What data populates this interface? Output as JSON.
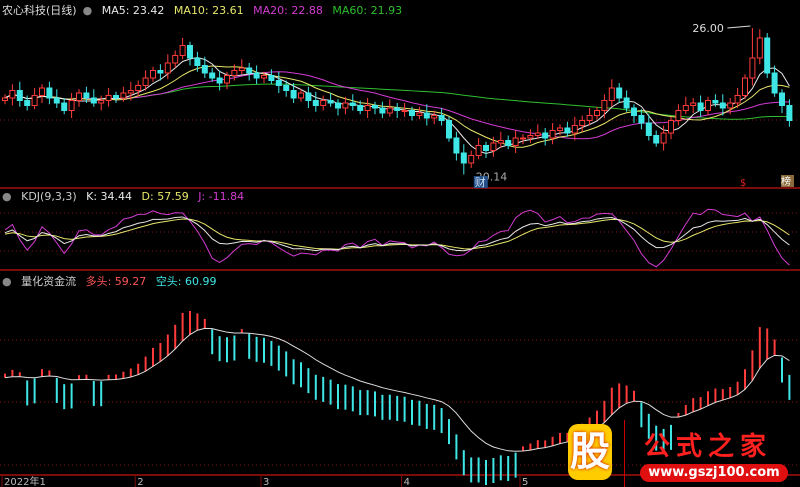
{
  "header": {
    "stock_name": "农心科技(日线)",
    "ma5_label": "MA5: 23.42",
    "ma10_label": "MA10: 23.61",
    "ma20_label": "MA20: 22.88",
    "ma60_label": "MA60: 21.93"
  },
  "kdj_header": {
    "title": "KDJ(9,3,3)",
    "k": "K: 34.44",
    "d": "D: 57.59",
    "j": "J: -11.84"
  },
  "flow_header": {
    "title": "量化资金流",
    "long": "多头: 59.27",
    "short": "空头: 60.99"
  },
  "annotations": {
    "high": "26.00",
    "low": "20.14",
    "badge_finance": "财",
    "badge_dollar": "$",
    "badge_right": "榜"
  },
  "xaxis": [
    "2022年1",
    "2",
    "3",
    "4",
    "5"
  ],
  "watermark": {
    "char": "股",
    "name": "公式之家",
    "url": "www.gszj100.com"
  },
  "colors": {
    "up": "#ff3b3b",
    "down": "#3ee6e6",
    "ma5": "#e8e8e8",
    "ma10": "#e6e66a",
    "ma20": "#d23cd2",
    "ma60": "#2fbf2f",
    "grid": "#8a1010"
  },
  "chart_data": {
    "type": "candlestick",
    "ylim": [
      19.8,
      26.4
    ],
    "month_start_index": [
      0,
      18,
      35,
      54,
      70
    ],
    "close": [
      23.2,
      23.5,
      23.1,
      22.9,
      23.3,
      23.6,
      23.2,
      23.0,
      22.7,
      23.1,
      23.4,
      23.2,
      23.0,
      23.1,
      23.3,
      23.2,
      23.4,
      23.5,
      23.7,
      24.0,
      24.3,
      24.2,
      24.6,
      24.9,
      25.3,
      24.8,
      24.5,
      24.2,
      24.0,
      23.8,
      24.1,
      24.3,
      24.4,
      24.2,
      24.0,
      24.1,
      23.9,
      23.7,
      23.5,
      23.2,
      23.4,
      23.1,
      22.9,
      23.1,
      23.0,
      22.8,
      23.0,
      22.9,
      22.7,
      22.9,
      22.8,
      22.6,
      22.8,
      22.7,
      22.7,
      22.5,
      22.6,
      22.4,
      22.5,
      22.3,
      21.6,
      21.0,
      20.6,
      20.9,
      21.3,
      21.1,
      21.4,
      21.5,
      21.3,
      21.6,
      21.6,
      21.7,
      21.8,
      21.6,
      21.9,
      22.0,
      21.8,
      22.1,
      22.3,
      22.5,
      22.7,
      23.1,
      23.6,
      23.2,
      22.8,
      22.5,
      22.2,
      21.7,
      21.4,
      21.8,
      22.3,
      22.7,
      22.9,
      23.0,
      22.7,
      23.1,
      23.0,
      22.8,
      23.0,
      23.3,
      24.0,
      24.8,
      25.6,
      24.2,
      23.4,
      22.9,
      22.3
    ]
  }
}
